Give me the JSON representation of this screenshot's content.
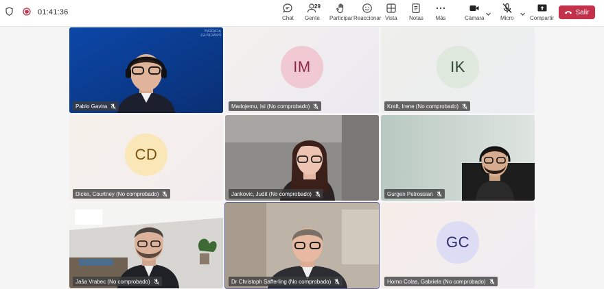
{
  "topbar": {
    "timer": "01:41:36",
    "buttons": {
      "chat": "Chat",
      "people": "Gente",
      "people_count": "29",
      "raise": "Participar",
      "react": "Reaccionar",
      "view": "Vista",
      "notes": "Notas",
      "more": "Más",
      "camera": "Cámara",
      "mic": "Micro",
      "share": "Compartir"
    },
    "leave": "Salir",
    "leave_color": "#c4314b"
  },
  "tiles": [
    {
      "name": "Pablo Gavira",
      "initials": "",
      "video": true,
      "bg": "#0d3b8c"
    },
    {
      "name": "Madojemu, Isi (No comprobado)",
      "initials": "IM",
      "avatar_bg": "#f1c9d2",
      "avatar_fg": "#8a2b46"
    },
    {
      "name": "Kraft, Irene (No comprobado)",
      "initials": "IK",
      "avatar_bg": "#dfe8dc",
      "avatar_fg": "#2d4a32"
    },
    {
      "name": "Dicke, Courtney (No comprobado)",
      "initials": "CD",
      "avatar_bg": "#fae7b8",
      "avatar_fg": "#7a5310"
    },
    {
      "name": "Jankovic, Judit (No comprobado)",
      "initials": "",
      "video": true
    },
    {
      "name": "Gurgen Petrossian",
      "initials": "",
      "video": true
    },
    {
      "name": "Jaša Vrabec (No comprobado)",
      "initials": "",
      "video": true
    },
    {
      "name": "Dr Christoph Safferling (No comprobado)",
      "initials": "",
      "video": true
    },
    {
      "name": "Horno Colas, Gabriela (No comprobado)",
      "initials": "GC",
      "avatar_bg": "#dcdcf4",
      "avatar_fg": "#2c2c6e"
    }
  ],
  "pablo_bg_text": "ACADEMY PRINCIPLES"
}
